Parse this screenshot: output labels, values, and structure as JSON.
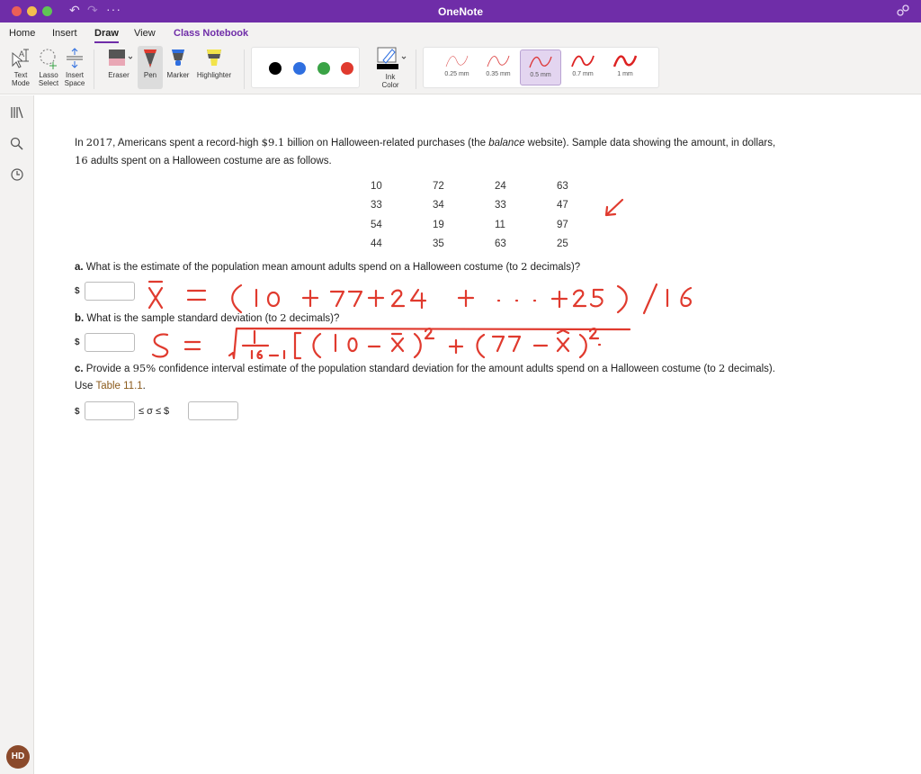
{
  "window": {
    "title": "OneNote"
  },
  "titlebar": {
    "undo_icon": "undo-icon",
    "redo_icon": "redo-icon",
    "more_label": "···"
  },
  "tabs": [
    {
      "label": "Home",
      "active": false
    },
    {
      "label": "Insert",
      "active": false
    },
    {
      "label": "Draw",
      "active": true
    },
    {
      "label": "View",
      "active": false
    },
    {
      "label": "Class Notebook",
      "active": false
    }
  ],
  "share": {
    "label": "Share"
  },
  "ribbon": {
    "text_mode": [
      "Text",
      "Mode"
    ],
    "lasso_select": [
      "Lasso",
      "Select"
    ],
    "insert_space": [
      "Insert",
      "Space"
    ],
    "eraser": "Eraser",
    "pen": "Pen",
    "marker": "Marker",
    "highlighter": "Highlighter",
    "ink_color": [
      "Ink",
      "Color"
    ],
    "colors": [
      {
        "name": "black",
        "hex": "#000000"
      },
      {
        "name": "blue",
        "hex": "#2f6fe0"
      },
      {
        "name": "green",
        "hex": "#3aa346"
      },
      {
        "name": "red",
        "hex": "#e03a2e",
        "selected": true
      }
    ],
    "widths": [
      {
        "label": "0.25 mm",
        "selected": false
      },
      {
        "label": "0.35 mm",
        "selected": false
      },
      {
        "label": "0.5 mm",
        "selected": true
      },
      {
        "label": "0.7 mm",
        "selected": false
      },
      {
        "label": "1 mm",
        "selected": false
      }
    ]
  },
  "user": {
    "initials": "HD"
  },
  "problem": {
    "intro_line1_a": "In ",
    "intro_year": "2017",
    "intro_line1_b": ", Americans spent a record-high ",
    "intro_amount": "$9.1",
    "intro_line1_c": " billion on Halloween-related purchases (the ",
    "intro_italic": "balance",
    "intro_line1_d": " website). Sample data showing the amount, in dollars,",
    "intro_count": "16",
    "intro_line2": " adults spent on a Halloween costume are as follows.",
    "data_rows": [
      [
        "10",
        "72",
        "24",
        "63"
      ],
      [
        "33",
        "34",
        "33",
        "47"
      ],
      [
        "54",
        "19",
        "11",
        "97"
      ],
      [
        "44",
        "35",
        "63",
        "25"
      ]
    ],
    "qa_label": "a.",
    "qa_text": " What is the estimate of the population mean amount adults spend on a Halloween costume (to ",
    "qa_dec": "2",
    "qa_end": " decimals)?",
    "qb_label": "b.",
    "qb_text": " What is the sample standard deviation (to ",
    "qb_dec": "2",
    "qb_end": " decimals)?",
    "qc_label": "c.",
    "qc_text": " Provide a ",
    "qc_pct": "95%",
    "qc_text2": " confidence interval estimate of the population standard deviation for the amount adults spend on a Halloween costume (to ",
    "qc_dec": "2",
    "qc_end": " decimals).",
    "qc_use": "Use ",
    "qc_link": "Table 11.1",
    "qc_period": ".",
    "dollar": "$",
    "sigma_text": "≤ σ ≤ $",
    "answers": {
      "a": "",
      "b": "",
      "c_low": "",
      "c_high": ""
    }
  },
  "ink_annotations": {
    "mean_formula": "x̄ = (10 + 72 + 24 + · · · + 25) / 16",
    "sd_formula": "S = √( 1/(16−1) [ (10 − x̄)² + (72 − x̄)² · ",
    "arrow": "arrow pointing to data table",
    "color": "#e03a2e"
  }
}
